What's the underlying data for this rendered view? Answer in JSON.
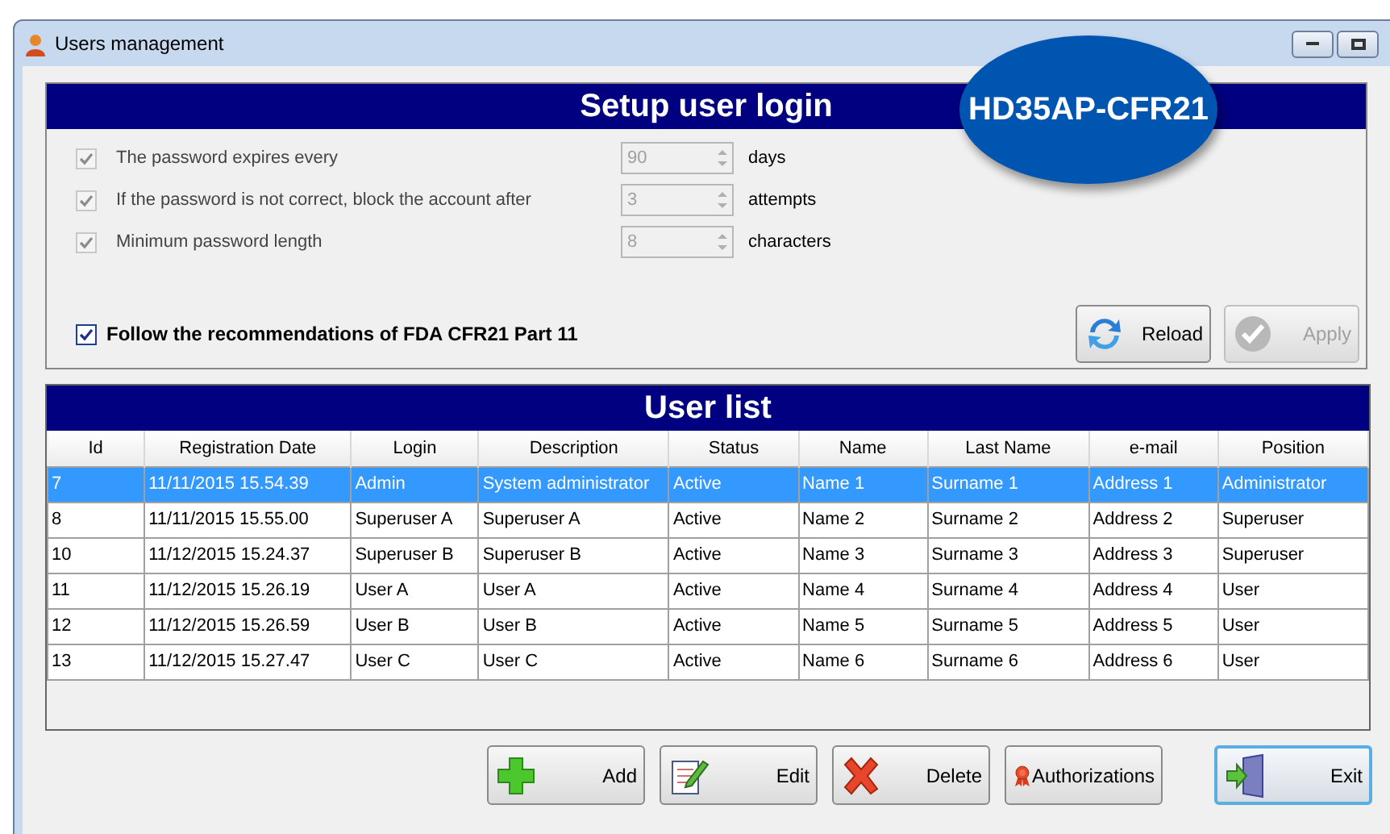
{
  "window": {
    "title": "Users management"
  },
  "badge": "HD35AP-CFR21",
  "setup": {
    "title": "Setup user login",
    "settings": [
      {
        "label": "The password expires every",
        "checked": true,
        "disabled": true,
        "value": "90",
        "unit": "days"
      },
      {
        "label": "If the password is not correct, block the account after",
        "checked": true,
        "disabled": true,
        "value": "3",
        "unit": "attempts"
      },
      {
        "label": "Minimum password length",
        "checked": true,
        "disabled": true,
        "value": "8",
        "unit": "characters"
      }
    ],
    "follow": {
      "label": "Follow the recommendations of FDA CFR21 Part 11",
      "checked": true
    },
    "buttons": [
      {
        "kind": "reload",
        "label": "Reload",
        "disabled": false
      },
      {
        "kind": "apply",
        "label": "Apply",
        "disabled": true
      }
    ]
  },
  "user_list": {
    "title": "User list",
    "columns": [
      "Id",
      "Registration Date",
      "Login",
      "Description",
      "Status",
      "Name",
      "Last Name",
      "e-mail",
      "Position"
    ],
    "rows": [
      {
        "selected": true,
        "cells": [
          "7",
          "11/11/2015 15.54.39",
          "Admin",
          "System administrator",
          "Active",
          "Name 1",
          "Surname 1",
          "Address 1",
          "Administrator"
        ]
      },
      {
        "selected": false,
        "cells": [
          "8",
          "11/11/2015 15.55.00",
          "Superuser A",
          "Superuser A",
          "Active",
          "Name 2",
          "Surname 2",
          "Address 2",
          "Superuser"
        ]
      },
      {
        "selected": false,
        "cells": [
          "10",
          "11/12/2015 15.24.37",
          "Superuser B",
          "Superuser B",
          "Active",
          "Name 3",
          "Surname 3",
          "Address 3",
          "Superuser"
        ]
      },
      {
        "selected": false,
        "cells": [
          "11",
          "11/12/2015 15.26.19",
          "User A",
          "User A",
          "Active",
          "Name 4",
          "Surname 4",
          "Address 4",
          "User"
        ]
      },
      {
        "selected": false,
        "cells": [
          "12",
          "11/12/2015 15.26.59",
          "User B",
          "User B",
          "Active",
          "Name 5",
          "Surname 5",
          "Address 5",
          "User"
        ]
      },
      {
        "selected": false,
        "cells": [
          "13",
          "11/12/2015 15.27.47",
          "User C",
          "User C",
          "Active",
          "Name 6",
          "Surname 6",
          "Address 6",
          "User"
        ]
      }
    ]
  },
  "actions": [
    {
      "kind": "add",
      "label": "Add",
      "focused": false
    },
    {
      "kind": "edit",
      "label": "Edit",
      "focused": false
    },
    {
      "kind": "delete",
      "label": "Delete",
      "focused": false
    },
    {
      "kind": "authorizations",
      "label": "Authorizations",
      "focused": false
    },
    {
      "kind": "exit",
      "label": "Exit",
      "focused": true
    }
  ]
}
